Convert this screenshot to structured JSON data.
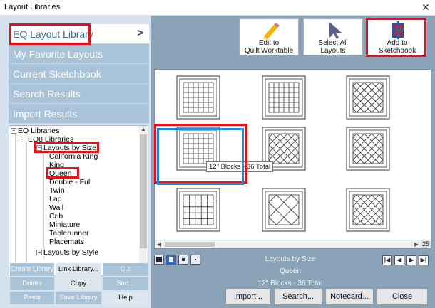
{
  "window": {
    "title": "Layout Libraries",
    "close_glyph": "✕"
  },
  "nav": {
    "items": [
      {
        "label": "EQ Layout Library",
        "chevron": ">"
      },
      {
        "label": "My Favorite Layouts"
      },
      {
        "label": "Current Sketchbook"
      },
      {
        "label": "Search Results"
      },
      {
        "label": "Import Results"
      }
    ]
  },
  "tree": {
    "root": "EQ Libraries",
    "eq8": "EQ8 Libraries",
    "by_size": "Layouts by Size",
    "sizes": [
      "California King",
      "King",
      "Queen",
      "Double - Full",
      "Twin",
      "Lap",
      "Wall",
      "Crib",
      "Miniature",
      "Tablerunner",
      "Placemats"
    ],
    "by_style": "Layouts by Style"
  },
  "left_buttons": {
    "create_library": "Create Library",
    "link_library": "Link Library...",
    "cut": "Cut",
    "delete": "Delete",
    "copy": "Copy",
    "sort": "Sort...",
    "paste": "Paste",
    "save_library": "Save Library",
    "help": "Help"
  },
  "toolbar": {
    "edit": {
      "line1": "Edit to",
      "line2": "Quilt Worktable",
      "icon": "pencil-icon"
    },
    "select_all": {
      "line1": "Select All",
      "line2": "Layouts",
      "icon": "cursor-icon"
    },
    "add": {
      "line1": "Add to",
      "line2": "Sketchbook",
      "icon": "add-to-sketchbook-icon"
    }
  },
  "gallery": {
    "tooltip": "12\" Blocks - 36 Total",
    "scroll_count": "25"
  },
  "status": {
    "line1": "Layouts by Size",
    "line2": "Queen",
    "line3": "12\" Blocks - 36 Total"
  },
  "nav_arrows": [
    "first-icon",
    "prev-icon",
    "next-icon",
    "last-icon"
  ],
  "bottom_buttons": {
    "import": "Import...",
    "search": "Search...",
    "notecard": "Notecard...",
    "close": "Close"
  },
  "colors": {
    "accent_red": "#e0131b",
    "selection_blue": "#1e88e5",
    "panel": "#8aa3b8",
    "nav": "#a9c3d8"
  }
}
